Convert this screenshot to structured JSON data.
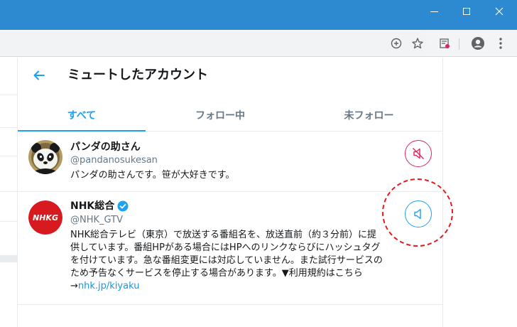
{
  "window": {
    "controls": {
      "minimize": "minimize",
      "maximize": "maximize",
      "close": "close"
    }
  },
  "toolbar": {
    "icons": [
      "add-circle-icon",
      "star-icon",
      "extension-icon",
      "account-icon",
      "menu-icon"
    ]
  },
  "panel": {
    "title": "ミュートしたアカウント",
    "tabs": [
      {
        "label": "すべて",
        "active": true
      },
      {
        "label": "フォロー中",
        "active": false
      },
      {
        "label": "未フォロー",
        "active": false
      }
    ],
    "users": [
      {
        "name": "パンダの助さん",
        "handle": "@pandanosukesan",
        "bio": "パンダの助さんです。笹が大好きです。",
        "verified": false,
        "muted": true
      },
      {
        "name": "NHK総合",
        "handle": "@NHK_GTV",
        "bio_lines": [
          "NHK総合テレビ（東京）で放送する番組名を、放送直前（約３分前）に提",
          "供しています。番組HPがある場合にはHPへのリンクならびにハッシュタグ",
          "を付けています。急な番組変更には対応していません。また試行サービスの",
          "ため予告なくサービスを停止する場合があります。▼利用規約はこちら"
        ],
        "bio_arrow": "→",
        "bio_link": "nhk.jp/kiyaku",
        "avatar_text": "NHKG",
        "verified": true,
        "muted": false
      }
    ]
  },
  "colors": {
    "accent": "#1da1f2",
    "mute_red": "#e0245e",
    "titlebar": "#2d8ad0",
    "highlight": "#e21c1c"
  }
}
